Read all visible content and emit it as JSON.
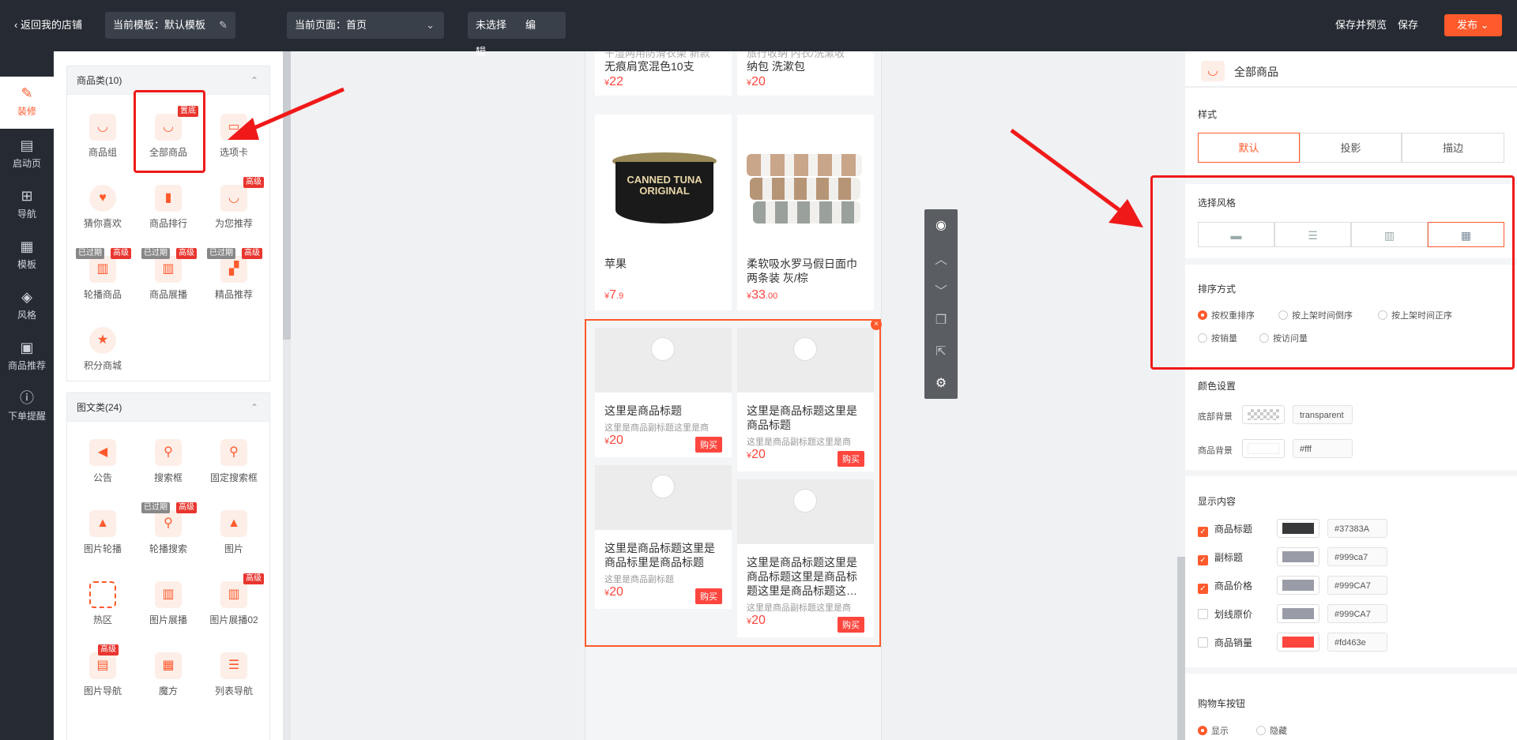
{
  "topbar": {
    "back": "返回我的店铺",
    "template": "当前模板：默认模板",
    "page": "当前页面：首页",
    "unselected": "未选择",
    "edit": "编辑",
    "save_preview": "保存并预览",
    "save": "保存",
    "publish": "发布"
  },
  "leftnav": [
    {
      "label": "装修",
      "icon": "brush-icon"
    },
    {
      "label": "启动页",
      "icon": "doc-icon"
    },
    {
      "label": "导航",
      "icon": "grid-icon"
    },
    {
      "label": "模板",
      "icon": "template-icon"
    },
    {
      "label": "风格",
      "icon": "paint-bucket-icon"
    },
    {
      "label": "商品推荐",
      "icon": "recommend-icon"
    },
    {
      "label": "下单提醒",
      "icon": "alert-icon"
    }
  ],
  "panel": {
    "sec1_title": "商品类(10)",
    "sec1_items": [
      "商品组",
      "全部商品",
      "选项卡",
      "猜你喜欢",
      "商品排行",
      "为您推荐",
      "轮播商品",
      "商品展播",
      "精品推荐",
      "积分商城"
    ],
    "badge_top": "置底",
    "badge_adv": "高级",
    "badge_exp": "已过期",
    "sec2_title": "图文类(24)",
    "sec2_items": [
      "公告",
      "搜索框",
      "固定搜索框",
      "图片轮播",
      "轮播搜索",
      "图片",
      "热区",
      "图片展播",
      "图片展播02",
      "图片导航",
      "魔方",
      "列表导航"
    ]
  },
  "phone": {
    "top_left_title": "无痕肩宽混色10支",
    "top_left_title_cut": "干湿两用防滑衣架 新款",
    "top_left_price": "22",
    "top_right_title": "纳包 洗漱包",
    "top_right_title_cut": "旅行收纳 内衣/洗漱收",
    "top_right_price": "20",
    "apple_title": "苹果",
    "apple_price": "7",
    "apple_price_dec": ".9",
    "can_label": "CANNED TUNA ORIGINAL",
    "towel_title": "柔软吸水罗马假日面巾两条装 灰/棕",
    "towel_price": "33",
    "towel_price_dec": ".00",
    "currency": "¥",
    "placeholders": [
      {
        "title": "这里是商品标题",
        "sub": "这里是商品副标题这里是商",
        "price": "20"
      },
      {
        "title": "这里是商品标题这里是商品标题",
        "sub": "这里是商品副标题这里是商",
        "price": "20"
      },
      {
        "title": "这里是商品标题这里是商品标里是商品标题",
        "sub": "这里是商品副标题",
        "price": "20"
      },
      {
        "title": "这里是商品标题这里是商品标题这里是商品标题这里是商品标题这…",
        "sub": "这里是商品副标题这里是商",
        "price": "20"
      }
    ],
    "buy": "购买"
  },
  "right": {
    "title": "全部商品",
    "style_label": "样式",
    "styles": [
      "默认",
      "投影",
      "描边"
    ],
    "choose_style": "选择风格",
    "sort_label": "排序方式",
    "sort_options": [
      "按权重排序",
      "按上架时间倒序",
      "按上架时间正序",
      "按销量",
      "按访问量"
    ],
    "color_label": "颜色设置",
    "bottom_bg": "底部背景",
    "bottom_bg_value": "transparent",
    "goods_bg": "商品背景",
    "goods_bg_value": "#fff",
    "display_label": "显示内容",
    "display_items": [
      {
        "label": "商品标题",
        "checked": true,
        "color": "#37383A"
      },
      {
        "label": "副标题",
        "checked": true,
        "color": "#999ca7"
      },
      {
        "label": "商品价格",
        "checked": true,
        "color": "#999CA7"
      },
      {
        "label": "划线原价",
        "checked": false,
        "color": "#999CA7"
      },
      {
        "label": "商品销量",
        "checked": false,
        "color": "#fd463e"
      }
    ],
    "cart_label": "购物车按钮",
    "cart_show": "显示",
    "cart_hide": "隐藏"
  },
  "colors": {
    "accent": "#ff5a2c",
    "dark": "#262b33",
    "price": "#fd463e"
  }
}
